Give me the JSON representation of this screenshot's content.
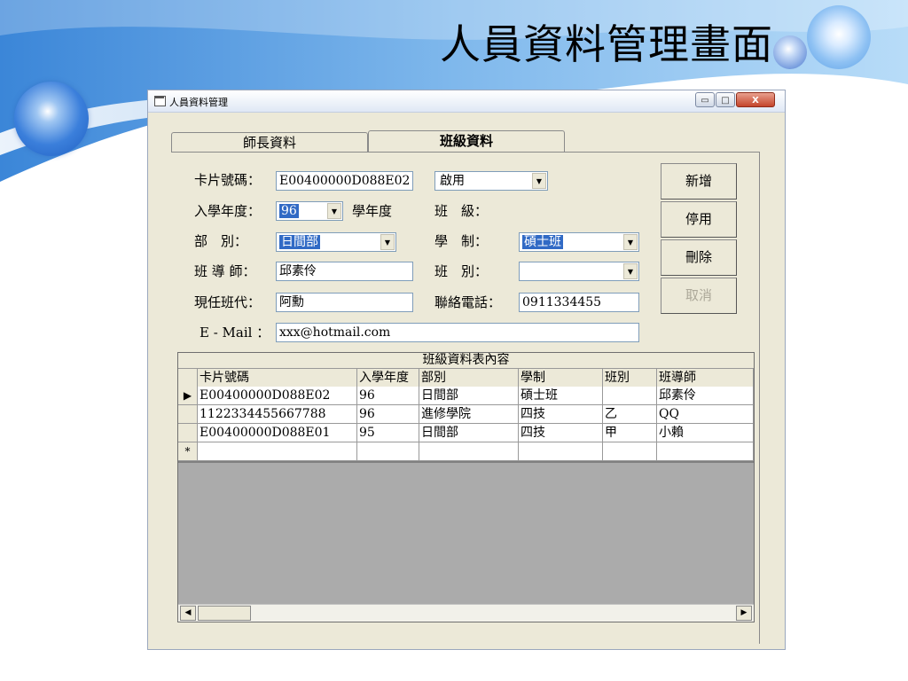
{
  "slide": {
    "title": "人員資料管理畫面"
  },
  "window": {
    "title": "人員資料管理",
    "controls": {
      "minimize": "▭",
      "maximize": "□",
      "close": "X"
    }
  },
  "tabs": [
    {
      "label": "師長資料",
      "active": false
    },
    {
      "label": "班級資料",
      "active": true
    }
  ],
  "form": {
    "card_no_label": "卡片號碼：",
    "card_no_value": "E00400000D088E02",
    "status_value": "啟用",
    "year_label": "入學年度：",
    "year_value": "96",
    "year_suffix": "學年度",
    "class_label": "班　級：",
    "dept_label": "部　別：",
    "dept_value": "日間部",
    "system_label": "學　制：",
    "system_value": "碩士班",
    "tutor_label": "班 導 師：",
    "tutor_value": "邱素伶",
    "section_label": "班　別：",
    "section_value": "",
    "leader_label": "現任班代：",
    "leader_value": "阿勳",
    "phone_label": "聯絡電話：",
    "phone_value": "0911334455",
    "email_label": "E - Mail ：",
    "email_value": "xxx@hotmail.com"
  },
  "actions": {
    "add": "新增",
    "disable": "停用",
    "delete": "刪除",
    "cancel": "取消"
  },
  "grid": {
    "caption": "班級資料表內容",
    "columns": [
      "卡片號碼",
      "入學年度",
      "部別",
      "學制",
      "班別",
      "班導師"
    ],
    "rows": [
      {
        "marker": "▶",
        "cells": [
          "E00400000D088E02",
          "96",
          "日間部",
          "碩士班",
          "",
          "邱素伶"
        ]
      },
      {
        "marker": "",
        "cells": [
          "1122334455667788",
          "96",
          "進修學院",
          "四技",
          "乙",
          "QQ"
        ]
      },
      {
        "marker": "",
        "cells": [
          "E00400000D088E01",
          "95",
          "日間部",
          "四技",
          "甲",
          "小賴"
        ]
      },
      {
        "marker": "*",
        "cells": [
          "",
          "",
          "",
          "",
          "",
          ""
        ]
      }
    ]
  },
  "colors": {
    "accent": "#316ac5",
    "window_bg": "#ece9d8",
    "grid_bg": "#ababab"
  }
}
